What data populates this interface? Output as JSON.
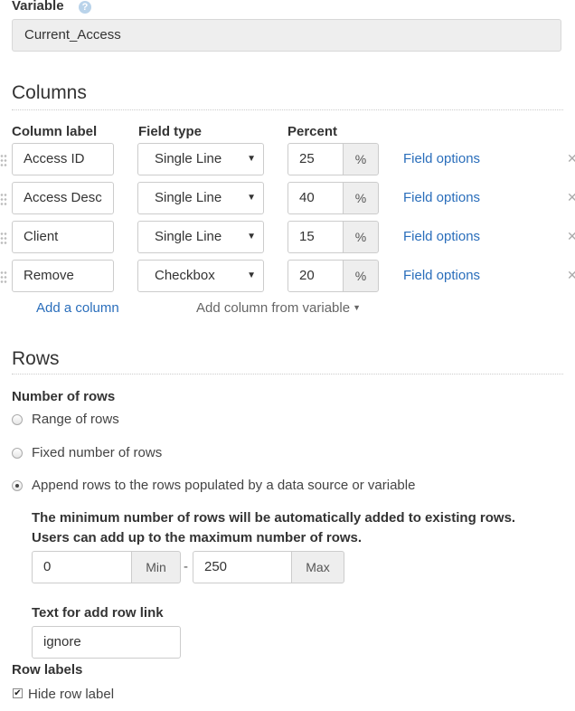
{
  "variable": {
    "label": "Variable",
    "help": "?",
    "value": "Current_Access"
  },
  "columns": {
    "title": "Columns",
    "headers": {
      "label": "Column label",
      "type": "Field type",
      "percent": "Percent"
    },
    "rows": [
      {
        "label": "Access ID",
        "type": "Single Line",
        "percent": "25",
        "unit": "%",
        "options": "Field options"
      },
      {
        "label": "Access Desc",
        "type": "Single Line",
        "percent": "40",
        "unit": "%",
        "options": "Field options"
      },
      {
        "label": "Client",
        "type": "Single Line",
        "percent": "15",
        "unit": "%",
        "options": "Field options"
      },
      {
        "label": "Remove",
        "type": "Checkbox",
        "percent": "20",
        "unit": "%",
        "options": "Field options"
      }
    ],
    "add_column": "Add a column",
    "add_from_variable": "Add column from variable"
  },
  "rows": {
    "title": "Rows",
    "number_label": "Number of rows",
    "options": [
      {
        "label": "Range of rows",
        "selected": false
      },
      {
        "label": "Fixed number of rows",
        "selected": false
      },
      {
        "label": "Append rows to the rows populated by a data source or variable",
        "selected": true
      }
    ],
    "info_line1": "The minimum number of rows will be automatically added to existing rows.",
    "info_line2": "Users can add up to the maximum number of rows.",
    "min_value": "0",
    "min_label": "Min",
    "dash": "-",
    "max_value": "250",
    "max_label": "Max",
    "add_row_label": "Text for add row link",
    "add_row_value": "ignore",
    "row_labels_title": "Row labels",
    "hide_row_label": "Hide row label",
    "hide_row_checked": true
  }
}
